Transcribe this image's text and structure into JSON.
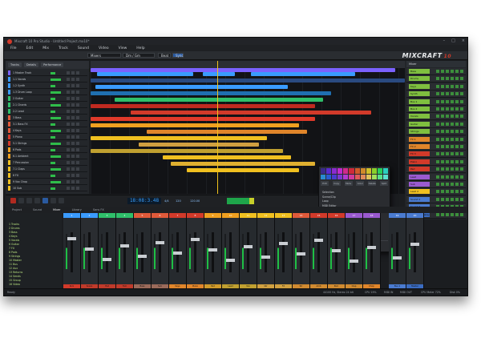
{
  "window": {
    "title": "Mixcraft 10 Pro Studio - Untitled Project.mx10*"
  },
  "menu": [
    "File",
    "Edit",
    "Mix",
    "Track",
    "Sound",
    "Video",
    "View",
    "Help"
  ],
  "toolbar": {
    "preset": "Mixers",
    "key": "Dm / Gm",
    "beat": "Beat",
    "sync": "Sync"
  },
  "brand": {
    "name": "MIXCRAFT",
    "version": "10"
  },
  "track_panel": {
    "tabs": [
      "Tracks",
      "Details",
      "Performance"
    ],
    "tracks": [
      {
        "name": "1 Master Track",
        "color": "#7b61ff"
      },
      {
        "name": "1.1 Vocals",
        "color": "#3a9bff"
      },
      {
        "name": "1.2 Synth",
        "color": "#3a9bff"
      },
      {
        "name": "1.3 Drum Loop",
        "color": "#3a9bff"
      },
      {
        "name": "2 Guitar",
        "color": "#2fbf6a"
      },
      {
        "name": "2.1 Chords",
        "color": "#2fbf6a"
      },
      {
        "name": "2.2 Lead",
        "color": "#2fbf6a"
      },
      {
        "name": "3 Bass",
        "color": "#e05a3a"
      },
      {
        "name": "3.1 Bass FX",
        "color": "#e05a3a"
      },
      {
        "name": "4 Keys",
        "color": "#e05a3a"
      },
      {
        "name": "5 Piano",
        "color": "#d23a2a"
      },
      {
        "name": "5.1 Strings",
        "color": "#d23a2a"
      },
      {
        "name": "6 Pads",
        "color": "#f0a020"
      },
      {
        "name": "6.1 Ambient",
        "color": "#f0a020"
      },
      {
        "name": "7 Percussion",
        "color": "#f0c020"
      },
      {
        "name": "7.1 Claps",
        "color": "#f0c020"
      },
      {
        "name": "8 FX",
        "color": "#f0c020"
      },
      {
        "name": "9 Vox Chop",
        "color": "#f0c020"
      },
      {
        "name": "10 Sub",
        "color": "#f0c020"
      }
    ]
  },
  "context_menu": {
    "icons": [
      "Edit",
      "Copy",
      "Mute",
      "Color",
      "Delete",
      "Split"
    ],
    "items": [
      "Selection",
      "Scene/Clip",
      "Loop",
      "MIDI Editor",
      "Quantize",
      "Humanize...",
      "Transpose",
      "Add MIDI Note...",
      "Edit MIDI Note...",
      "Split at Pointer",
      "Convert Selected MIDI Clips",
      "Double Selected MIDI Clips",
      "Set Hit Mark Clip"
    ]
  },
  "inspector": {
    "header": "Mixer",
    "rows": [
      {
        "label": "Bass",
        "color": "#7fbf3f"
      },
      {
        "label": "Drums",
        "color": "#7fbf3f"
      },
      {
        "label": "Keys",
        "color": "#7fbf3f"
      },
      {
        "label": "Synth",
        "color": "#7fbf3f"
      },
      {
        "label": "Bus 1",
        "color": "#7fbf3f"
      },
      {
        "label": "Bus 2",
        "color": "#7fbf3f"
      },
      {
        "label": "Vocals",
        "color": "#7fbf3f"
      },
      {
        "label": "Guitar",
        "color": "#7fbf3f"
      },
      {
        "label": "Strings",
        "color": "#7fbf3f"
      },
      {
        "label": "FX 1",
        "color": "#e0852a"
      },
      {
        "label": "FX 2",
        "color": "#e0852a"
      },
      {
        "label": "FX 3",
        "color": "#d23a2a"
      },
      {
        "label": "Piano",
        "color": "#d23a2a"
      },
      {
        "label": "Pad",
        "color": "#d23a2a"
      },
      {
        "label": "Lead",
        "color": "#9a5ad0"
      },
      {
        "label": "Sub",
        "color": "#9a5ad0"
      },
      {
        "label": "Lead 2",
        "color": "#f0c020"
      },
      {
        "label": "Sound 1",
        "color": "#4a7bd0"
      },
      {
        "label": "Sound 2",
        "color": "#4a7bd0"
      },
      {
        "label": "Extended Delay",
        "color": "#3a6bc0"
      }
    ]
  },
  "transport": {
    "time": "18:08:3.48",
    "bpm": "4/4",
    "tempo": "120",
    "key": "120.00"
  },
  "console": {
    "tabs": [
      "Project",
      "Sound",
      "Mixer",
      "Library",
      "Sans FX"
    ],
    "browser": [
      "1 Tracks",
      "2 Drums",
      "3 Bass",
      "4 Keys",
      "5 Vocals",
      "6 Guitar",
      "7 FX",
      "8 Pads",
      "9 Strings",
      "10 Master",
      "11 Bus",
      "12 Aux",
      "13 Returns",
      "14 Sends",
      "15 Group",
      "16 Video"
    ],
    "strips": [
      {
        "name": "1",
        "color": "#3a9bff",
        "foot": "Kick",
        "foot_color": "#d23a2a"
      },
      {
        "name": "2",
        "color": "#3a9bff",
        "foot": "Snare",
        "foot_color": "#c03a2a"
      },
      {
        "name": "3",
        "color": "#2fbf6a",
        "foot": "Hat",
        "foot_color": "#c03a2a"
      },
      {
        "name": "4",
        "color": "#2fbf6a",
        "foot": "Tom",
        "foot_color": "#c03a2a"
      },
      {
        "name": "5",
        "color": "#e05a3a",
        "foot": "Bass",
        "foot_color": "#9a6a5a"
      },
      {
        "name": "6",
        "color": "#e05a3a",
        "foot": "Sub",
        "foot_color": "#9a6a5a"
      },
      {
        "name": "7",
        "color": "#d23a2a",
        "foot": "Keys",
        "foot_color": "#e0852a"
      },
      {
        "name": "8",
        "color": "#d23a2a",
        "foot": "Piano",
        "foot_color": "#e0852a"
      },
      {
        "name": "9",
        "color": "#f0a020",
        "foot": "Pad",
        "foot_color": "#d09a2a"
      },
      {
        "name": "10",
        "color": "#f0a020",
        "foot": "Lead",
        "foot_color": "#c0a030"
      },
      {
        "name": "11",
        "color": "#f0c020",
        "foot": "Vox",
        "foot_color": "#c0a030"
      },
      {
        "name": "12",
        "color": "#f0c020",
        "foot": "Gtr",
        "foot_color": "#d0a040"
      },
      {
        "name": "13",
        "color": "#f0c020",
        "foot": "FX",
        "foot_color": "#d0a040"
      },
      {
        "name": "14",
        "color": "#e05a3a",
        "foot": "Str",
        "foot_color": "#d08a30"
      },
      {
        "name": "15",
        "color": "#d23a2a",
        "foot": "Amb",
        "foot_color": "#d08a30"
      },
      {
        "name": "16",
        "color": "#d23a2a",
        "foot": "Perc",
        "foot_color": "#d08a30"
      },
      {
        "name": "17",
        "color": "#9a5ad0",
        "foot": "Clap",
        "foot_color": "#d08a30"
      },
      {
        "name": "18",
        "color": "#9a5ad0",
        "foot": "Chop",
        "foot_color": "#e0852a"
      },
      {
        "name": "19",
        "color": "#4a7bd0",
        "foot": "Bus 1",
        "foot_color": "#4a7bd0"
      },
      {
        "name": "20",
        "color": "#4a7bd0",
        "foot": "Master",
        "foot_color": "#3a6bc0"
      }
    ]
  },
  "status": {
    "left": "Ready",
    "center": "44100 Hz, Stereo 24 bit",
    "cpu": "CPU 19%",
    "midi": "MIDI IN",
    "sync": "MIDI OUT",
    "disk": "CPU Meter 72%",
    "right": "Disk 0%"
  }
}
